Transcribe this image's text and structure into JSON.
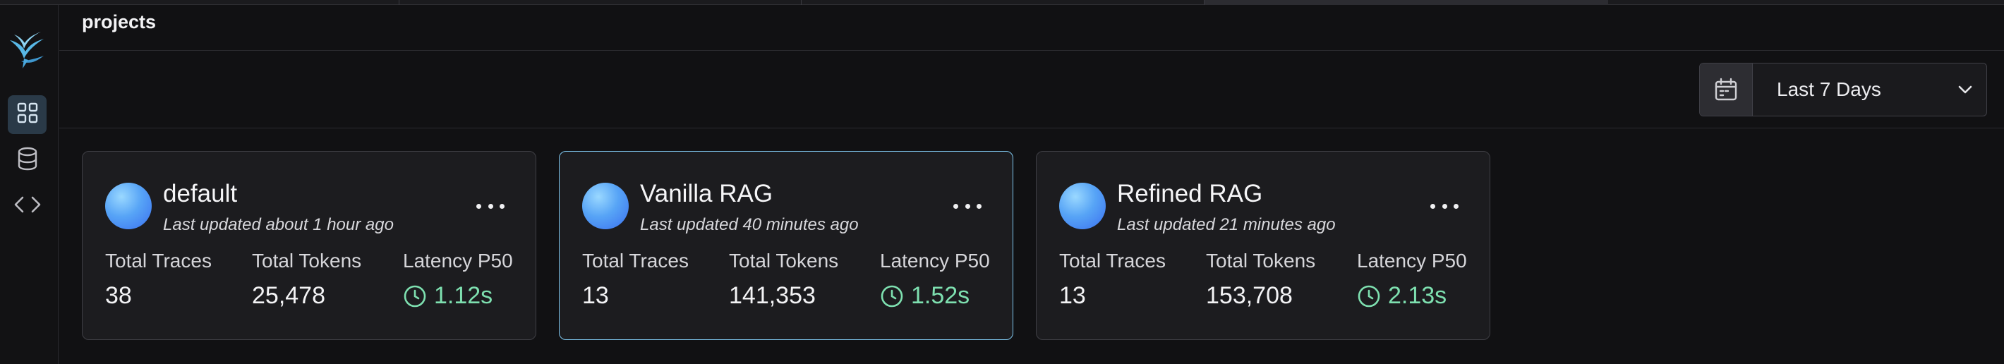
{
  "header": {
    "title": "projects"
  },
  "sidebar": {
    "items": [
      {
        "icon": "grid-icon",
        "active": true
      },
      {
        "icon": "database-icon",
        "active": false
      },
      {
        "icon": "code-icon",
        "active": false
      }
    ]
  },
  "toolbar": {
    "date_range": "Last 7 Days"
  },
  "stat_labels": {
    "traces": "Total Traces",
    "tokens": "Total Tokens",
    "latency": "Latency P50"
  },
  "projects": [
    {
      "name": "default",
      "updated": "Last updated about 1 hour ago",
      "traces": "38",
      "tokens": "25,478",
      "latency": "1.12s",
      "selected": false
    },
    {
      "name": "Vanilla RAG",
      "updated": "Last updated 40 minutes ago",
      "traces": "13",
      "tokens": "141,353",
      "latency": "1.52s",
      "selected": true
    },
    {
      "name": "Refined RAG",
      "updated": "Last updated 21 minutes ago",
      "traces": "13",
      "tokens": "153,708",
      "latency": "2.13s",
      "selected": false
    }
  ],
  "colors": {
    "accent": "#7fc7ef",
    "latency": "#7ee0b0",
    "background": "#111113"
  }
}
